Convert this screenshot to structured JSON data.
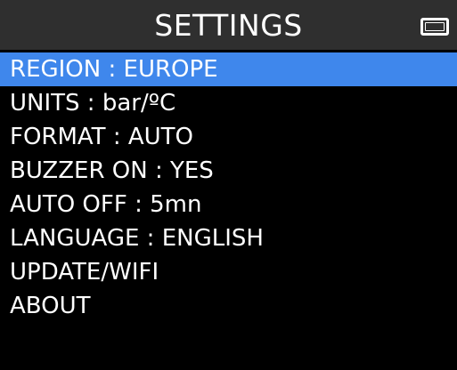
{
  "header": {
    "title": "SETTINGS",
    "battery_icon": "battery-icon"
  },
  "menu": {
    "selected_index": 0,
    "items": [
      {
        "label": "REGION : EUROPE"
      },
      {
        "label": "UNITS : bar/ºC"
      },
      {
        "label": "FORMAT : AUTO"
      },
      {
        "label": "BUZZER ON : YES"
      },
      {
        "label": "AUTO OFF : 5mn"
      },
      {
        "label": "LANGUAGE : ENGLISH"
      },
      {
        "label": "UPDATE/WIFI"
      },
      {
        "label": "ABOUT"
      }
    ]
  },
  "colors": {
    "background": "#000000",
    "header": "#2f2f2f",
    "selection": "#3f87ec",
    "text": "#ffffff"
  }
}
